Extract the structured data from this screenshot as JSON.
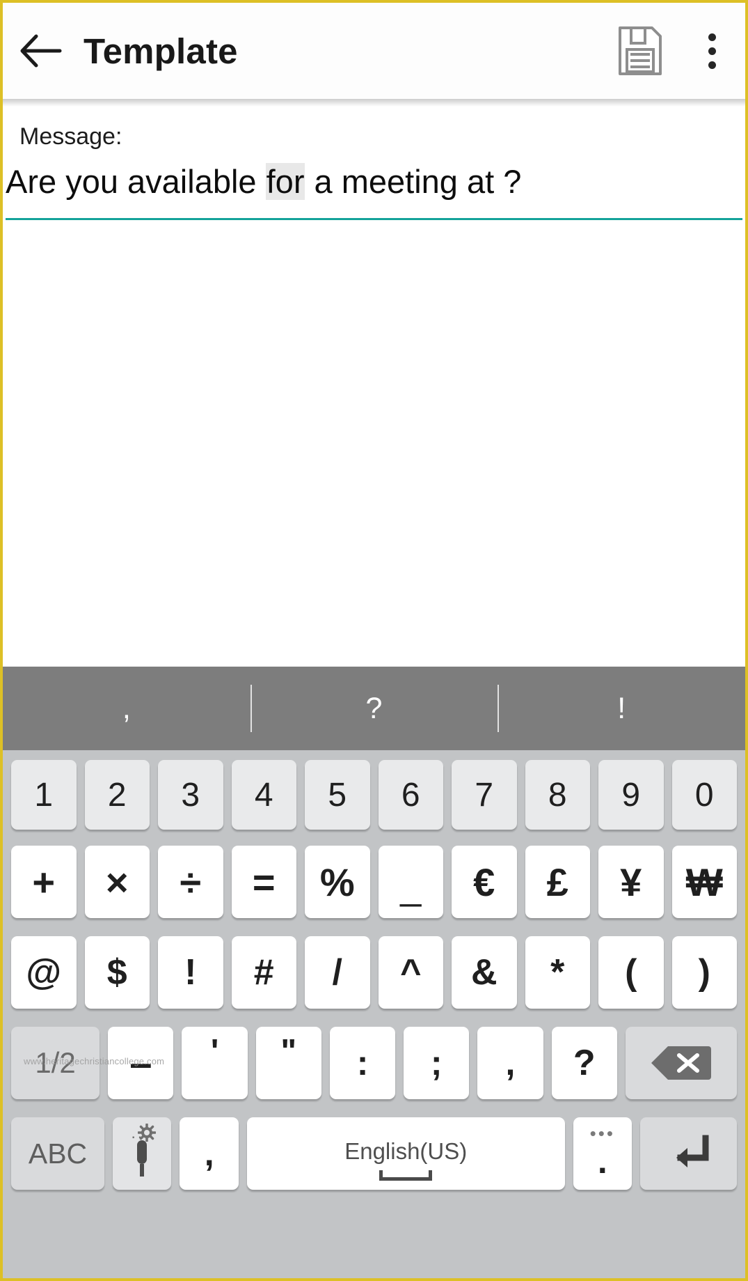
{
  "appbar": {
    "back_icon": "back-arrow-icon",
    "title": "Template",
    "save_icon": "floppy-disk-save-icon",
    "overflow_icon": "more-vertical-icon"
  },
  "editor": {
    "label": "Message:",
    "text_before": "Are you available ",
    "text_highlight": "for",
    "text_after": " a meeting at  ?",
    "accent_color": "#14a39a"
  },
  "suggestions": [
    {
      "label": ","
    },
    {
      "label": "?"
    },
    {
      "label": "!"
    }
  ],
  "keyboard": {
    "row1": [
      {
        "label": "1"
      },
      {
        "label": "2"
      },
      {
        "label": "3"
      },
      {
        "label": "4"
      },
      {
        "label": "5"
      },
      {
        "label": "6"
      },
      {
        "label": "7"
      },
      {
        "label": "8"
      },
      {
        "label": "9"
      },
      {
        "label": "0"
      }
    ],
    "row2": [
      {
        "label": "+"
      },
      {
        "label": "×"
      },
      {
        "label": "÷"
      },
      {
        "label": "="
      },
      {
        "label": "%"
      },
      {
        "label": "_"
      },
      {
        "label": "€"
      },
      {
        "label": "£"
      },
      {
        "label": "¥"
      },
      {
        "label": "₩"
      }
    ],
    "row3": [
      {
        "label": "@"
      },
      {
        "label": "$"
      },
      {
        "label": "!"
      },
      {
        "label": "#"
      },
      {
        "label": "/"
      },
      {
        "label": "^"
      },
      {
        "label": "&"
      },
      {
        "label": "*"
      },
      {
        "label": "("
      },
      {
        "label": ")"
      }
    ],
    "row4": [
      {
        "label": "1/2"
      },
      {
        "label": "–"
      },
      {
        "label": "'"
      },
      {
        "label": "\""
      },
      {
        "label": ":"
      },
      {
        "label": ";"
      },
      {
        "label": ","
      },
      {
        "label": "?"
      },
      {
        "label": "backspace-icon"
      }
    ],
    "row5": {
      "abc": "ABC",
      "mic": "microphone-settings-icon",
      "comma": ",",
      "space_label": "English(US)",
      "period": ".",
      "enter": "enter-return-icon"
    }
  },
  "watermark": "www.heritagechristiancollege.com"
}
